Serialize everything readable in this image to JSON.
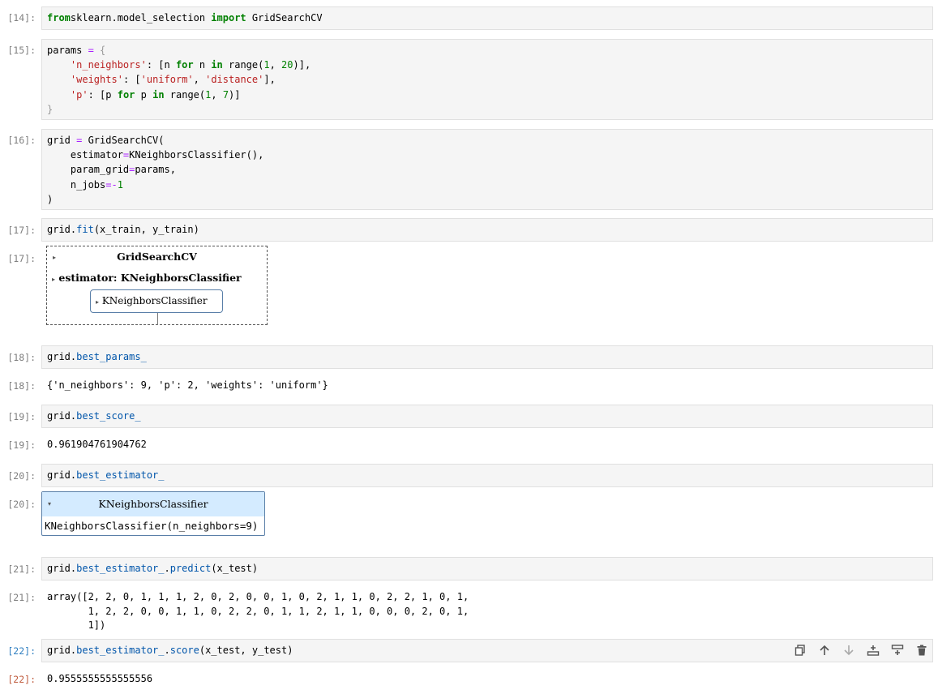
{
  "cells": [
    {
      "prompt": "[14]:",
      "lines": [
        [
          [
            "kw",
            "from"
          ],
          [
            "",
            "sklearn.model_selection "
          ],
          [
            "kw",
            "import"
          ],
          [
            "",
            " GridSearchCV"
          ]
        ]
      ]
    },
    {
      "prompt": "[15]:",
      "lines": [
        [
          [
            "",
            "params "
          ],
          [
            "op",
            "="
          ],
          [
            "",
            " "
          ],
          [
            "br",
            "{"
          ]
        ],
        [
          [
            "",
            "    "
          ],
          [
            "st",
            "'n_neighbors'"
          ],
          [
            "",
            ": [n "
          ],
          [
            "kw",
            "for"
          ],
          [
            "",
            " n "
          ],
          [
            "kw",
            "in"
          ],
          [
            "",
            " range("
          ],
          [
            "nu",
            "1"
          ],
          [
            "",
            ", "
          ],
          [
            "nu",
            "20"
          ],
          [
            "",
            ")],"
          ]
        ],
        [
          [
            "",
            "    "
          ],
          [
            "st",
            "'weights'"
          ],
          [
            "",
            ": ["
          ],
          [
            "st",
            "'uniform'"
          ],
          [
            "",
            ", "
          ],
          [
            "st",
            "'distance'"
          ],
          [
            "",
            "],"
          ]
        ],
        [
          [
            "",
            "    "
          ],
          [
            "st",
            "'p'"
          ],
          [
            "",
            ": [p "
          ],
          [
            "kw",
            "for"
          ],
          [
            "",
            " p "
          ],
          [
            "kw",
            "in"
          ],
          [
            "",
            " range("
          ],
          [
            "nu",
            "1"
          ],
          [
            "",
            ", "
          ],
          [
            "nu",
            "7"
          ],
          [
            "",
            ")]"
          ]
        ],
        [
          [
            "br",
            "}"
          ]
        ]
      ]
    },
    {
      "prompt": "[16]:",
      "lines": [
        [
          [
            "",
            "grid "
          ],
          [
            "op",
            "="
          ],
          [
            "",
            " GridSearchCV("
          ]
        ],
        [
          [
            "",
            "    estimator"
          ],
          [
            "op",
            "="
          ],
          [
            "",
            "KNeighborsClassifier(),"
          ]
        ],
        [
          [
            "",
            "    param_grid"
          ],
          [
            "op",
            "="
          ],
          [
            "",
            "params,"
          ]
        ],
        [
          [
            "",
            "    n_jobs"
          ],
          [
            "op",
            "=-"
          ],
          [
            "nu",
            "1"
          ]
        ],
        [
          [
            "",
            ")"
          ]
        ]
      ]
    },
    {
      "prompt": "[17]:",
      "lines": [
        [
          [
            "",
            "grid."
          ],
          [
            "at",
            "fit"
          ],
          [
            "",
            "(x_train, y_train)"
          ]
        ]
      ]
    },
    {
      "prompt": "[18]:",
      "lines": [
        [
          [
            "",
            "grid."
          ],
          [
            "at",
            "best_params_"
          ]
        ]
      ]
    },
    {
      "prompt": "[19]:",
      "lines": [
        [
          [
            "",
            "grid."
          ],
          [
            "at",
            "best_score_"
          ]
        ]
      ]
    },
    {
      "prompt": "[20]:",
      "lines": [
        [
          [
            "",
            "grid."
          ],
          [
            "at",
            "best_estimator_"
          ]
        ]
      ]
    },
    {
      "prompt": "[21]:",
      "lines": [
        [
          [
            "",
            "grid."
          ],
          [
            "at",
            "best_estimator_"
          ],
          [
            "",
            "."
          ],
          [
            "at",
            "predict"
          ],
          [
            "",
            "(x_test)"
          ]
        ]
      ]
    },
    {
      "prompt": "[22]:",
      "lines": [
        [
          [
            "",
            "grid."
          ],
          [
            "at",
            "best_estimator_"
          ],
          [
            "",
            "."
          ],
          [
            "at",
            "score"
          ],
          [
            "",
            "(x_test, y_test)"
          ]
        ]
      ]
    }
  ],
  "outputs": {
    "o17_prompt": "[17]:",
    "o17_title": "GridSearchCV",
    "o17_estimator": "estimator: KNeighborsClassifier",
    "o17_inner": "KNeighborsClassifier",
    "o18_prompt": "[18]:",
    "o18_text": "{'n_neighbors': 9, 'p': 2, 'weights': 'uniform'}",
    "o19_prompt": "[19]:",
    "o19_text": "0.961904761904762",
    "o20_prompt": "[20]:",
    "o20_title": "KNeighborsClassifier",
    "o20_body": "KNeighborsClassifier(n_neighbors=9)",
    "o21_prompt": "[21]:",
    "o21_text": "array([2, 2, 0, 1, 1, 1, 2, 0, 2, 0, 0, 1, 0, 2, 1, 1, 0, 2, 2, 1, 0, 1,\n       1, 2, 2, 0, 0, 1, 1, 0, 2, 2, 0, 1, 1, 2, 1, 1, 0, 0, 0, 2, 0, 1,\n       1])",
    "o22_prompt": "[22]:",
    "o22_text": "0.9555555555555556"
  },
  "toolbar": {
    "icons": [
      "duplicate-icon",
      "move-up-icon",
      "move-down-icon",
      "insert-above-icon",
      "insert-below-icon",
      "delete-icon"
    ]
  },
  "colors": {
    "active_prompt": "#307fc1",
    "active_out_prompt": "#bf5b3d",
    "keyword": "#008000",
    "string": "#ba2121",
    "attribute": "#0055aa",
    "estimator_header": "#d4ebff"
  }
}
